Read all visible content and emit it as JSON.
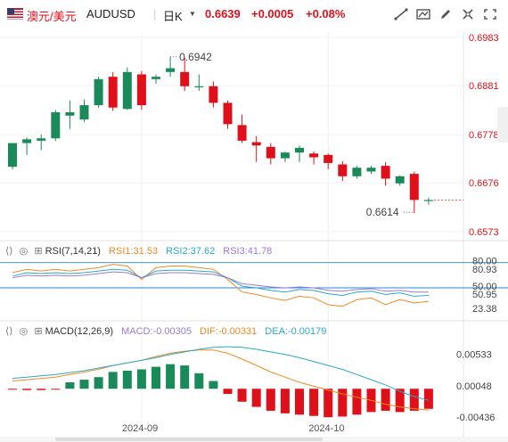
{
  "header": {
    "flag_icon": "us-flag-icon",
    "symbol_cn": "澳元/美元",
    "symbol": "AUDUSD",
    "timeframe": "日K",
    "price": "0.6639",
    "change": "+0.0005",
    "change_pct": "+0.08%",
    "tools": [
      "draw-line-icon",
      "indicator-icon",
      "pen-icon",
      "settings-icon",
      "fullscreen-icon"
    ]
  },
  "colors": {
    "up": "#1a8a5a",
    "down": "#e0101a",
    "last_price": "#e0101a",
    "accent": "#2a6ad1"
  },
  "panels": {
    "rsi": {
      "title": "RSI(7,14,21)",
      "rsi1": "RSI1:31.53",
      "rsi2": "RSI2:37.62",
      "rsi3": "RSI3:41.78"
    },
    "macd": {
      "title": "MACD(12,26,9)",
      "macd": "MACD:-0.00305",
      "dif": "DIF:-0.00331",
      "dea": "DEA:-0.00179"
    }
  },
  "chart_data": [
    {
      "type": "candlestick",
      "title": "AUDUSD 日K",
      "x_tick_labels": [
        "2024-09",
        "2024-10"
      ],
      "y_tick_labels": [
        "0.6983",
        "0.6881",
        "0.6778",
        "0.6676",
        "0.6573"
      ],
      "ylim": [
        0.6573,
        0.6983
      ],
      "annotations": [
        {
          "text": "0.6942",
          "value": 0.6942
        },
        {
          "text": "0.6614",
          "value": 0.6614
        }
      ],
      "ohlc": [
        [
          0.671,
          0.676,
          0.6705,
          0.676
        ],
        [
          0.676,
          0.6772,
          0.6735,
          0.6768
        ],
        [
          0.6765,
          0.6778,
          0.6745,
          0.677
        ],
        [
          0.677,
          0.683,
          0.6765,
          0.6825
        ],
        [
          0.6818,
          0.685,
          0.679,
          0.6825
        ],
        [
          0.681,
          0.6852,
          0.6805,
          0.684
        ],
        [
          0.684,
          0.69,
          0.6835,
          0.6895
        ],
        [
          0.69,
          0.691,
          0.6828,
          0.6835
        ],
        [
          0.6832,
          0.692,
          0.683,
          0.691
        ],
        [
          0.6905,
          0.6912,
          0.683,
          0.684
        ],
        [
          0.6895,
          0.6905,
          0.6885,
          0.69
        ],
        [
          0.691,
          0.6942,
          0.69,
          0.6918
        ],
        [
          0.691,
          0.694,
          0.687,
          0.688
        ],
        [
          0.688,
          0.6905,
          0.687,
          0.688
        ],
        [
          0.688,
          0.689,
          0.6835,
          0.6845
        ],
        [
          0.6845,
          0.685,
          0.679,
          0.68
        ],
        [
          0.6798,
          0.682,
          0.676,
          0.6765
        ],
        [
          0.6762,
          0.6775,
          0.672,
          0.6755
        ],
        [
          0.6752,
          0.676,
          0.6715,
          0.6728
        ],
        [
          0.6728,
          0.6742,
          0.672,
          0.674
        ],
        [
          0.674,
          0.6755,
          0.672,
          0.675
        ],
        [
          0.6738,
          0.6742,
          0.6715,
          0.673
        ],
        [
          0.6735,
          0.6738,
          0.6705,
          0.6718
        ],
        [
          0.6715,
          0.6722,
          0.668,
          0.669
        ],
        [
          0.669,
          0.6712,
          0.6685,
          0.6708
        ],
        [
          0.67,
          0.6712,
          0.6695,
          0.6708
        ],
        [
          0.6712,
          0.672,
          0.667,
          0.6685
        ],
        [
          0.6675,
          0.6692,
          0.667,
          0.669
        ],
        [
          0.6695,
          0.67,
          0.6612,
          0.664
        ],
        [
          0.6638,
          0.6645,
          0.663,
          0.664
        ]
      ]
    },
    {
      "type": "line",
      "title": "RSI(7,14,21)",
      "y_tick_labels": [
        "80.00",
        "80.93",
        "50.00",
        "50.95",
        "23.38"
      ],
      "ylim": [
        15,
        85
      ],
      "series": [
        {
          "name": "RSI1",
          "color": "#f08a24",
          "values": [
            68,
            72,
            70,
            72,
            70,
            72,
            74,
            78,
            76,
            60,
            74,
            76,
            76,
            74,
            72,
            60,
            45,
            42,
            38,
            35,
            40,
            38,
            30,
            28,
            36,
            38,
            30,
            36,
            32,
            34
          ]
        },
        {
          "name": "RSI2",
          "color": "#2aa8c8",
          "values": [
            64,
            68,
            67,
            68,
            67,
            68,
            70,
            72,
            71,
            62,
            70,
            71,
            71,
            70,
            69,
            62,
            52,
            50,
            47,
            45,
            48,
            47,
            43,
            41,
            45,
            46,
            42,
            44,
            40,
            41
          ]
        },
        {
          "name": "RSI3",
          "color": "#9a7ad8",
          "values": [
            62,
            65,
            64,
            65,
            64,
            65,
            67,
            69,
            68,
            62,
            67,
            68,
            68,
            67,
            66,
            62,
            55,
            53,
            51,
            50,
            51,
            50,
            47,
            46,
            48,
            49,
            46,
            47,
            45,
            45
          ]
        }
      ]
    },
    {
      "type": "bar+line",
      "title": "MACD(12,26,9)",
      "y_tick_labels": [
        "0.00533",
        "0.00048",
        "-0.00436"
      ],
      "ylim": [
        -0.0052,
        0.0072
      ],
      "macd": [
        -0.0001,
        -0.0002,
        -0.0002,
        -0.0001,
        0.001,
        0.0014,
        0.0018,
        0.0026,
        0.0028,
        0.003,
        0.0034,
        0.0038,
        0.0036,
        0.0024,
        0.0012,
        -0.0008,
        -0.002,
        -0.0028,
        -0.0034,
        -0.0038,
        -0.004,
        -0.0042,
        -0.0044,
        -0.0043,
        -0.004,
        -0.0036,
        -0.0034,
        -0.0036,
        -0.0034,
        -0.0031
      ],
      "dif": [
        0.0012,
        0.0014,
        0.0016,
        0.0018,
        0.0022,
        0.0026,
        0.003,
        0.0036,
        0.004,
        0.0044,
        0.005,
        0.0055,
        0.0058,
        0.006,
        0.006,
        0.0055,
        0.0046,
        0.0036,
        0.0026,
        0.0018,
        0.001,
        0.0004,
        -0.0002,
        -0.0008,
        -0.0013,
        -0.0018,
        -0.0024,
        -0.0028,
        -0.0031,
        -0.0033
      ],
      "dea": [
        0.0016,
        0.0018,
        0.002,
        0.0022,
        0.0025,
        0.0028,
        0.0032,
        0.0036,
        0.004,
        0.0044,
        0.0048,
        0.0053,
        0.0057,
        0.0061,
        0.0064,
        0.0065,
        0.0064,
        0.0061,
        0.0057,
        0.0053,
        0.0048,
        0.0042,
        0.0036,
        0.003,
        0.0022,
        0.0014,
        0.0006,
        -0.0004,
        -0.0012,
        -0.0018
      ]
    }
  ]
}
